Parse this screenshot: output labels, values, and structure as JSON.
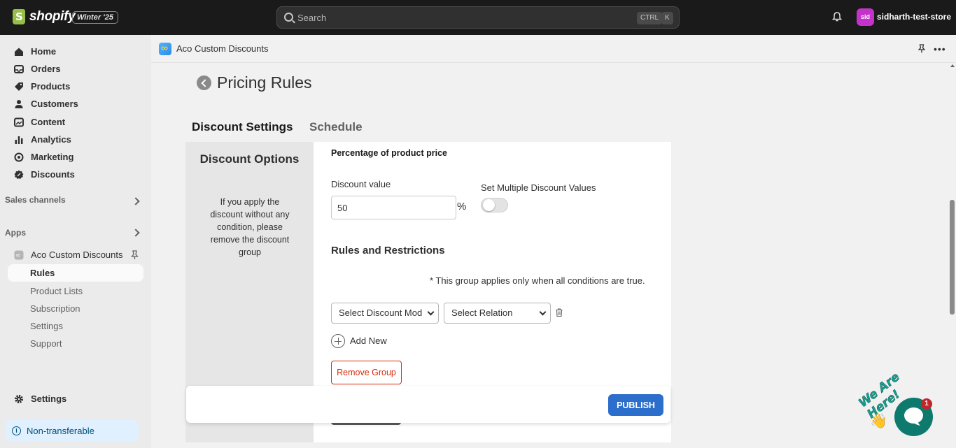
{
  "topbar": {
    "brand": "shopify",
    "edition_badge": "Winter '25",
    "search_placeholder": "Search",
    "kbd_ctrl": "CTRL",
    "kbd_k": "K",
    "store_initials": "sid",
    "store_name": "sidharth-test-store"
  },
  "sidebar": {
    "items": [
      {
        "label": "Home",
        "icon": "home-icon"
      },
      {
        "label": "Orders",
        "icon": "inbox-icon"
      },
      {
        "label": "Products",
        "icon": "tag-icon"
      },
      {
        "label": "Customers",
        "icon": "person-icon"
      },
      {
        "label": "Content",
        "icon": "image-icon"
      },
      {
        "label": "Analytics",
        "icon": "bar-chart-icon"
      },
      {
        "label": "Marketing",
        "icon": "target-icon"
      },
      {
        "label": "Discounts",
        "icon": "discount-icon"
      }
    ],
    "sales_channels": "Sales channels",
    "apps": "Apps",
    "app_name": "Aco Custom Discounts",
    "app_subitems": [
      "Rules",
      "Product Lists",
      "Subscription",
      "Settings",
      "Support"
    ],
    "settings": "Settings",
    "non_transferable": "Non-transferable"
  },
  "app_header": {
    "title": "Aco Custom Discounts"
  },
  "page": {
    "title": "Pricing Rules",
    "tabs": [
      "Discount Settings",
      "Schedule"
    ],
    "options_title": "Discount Options",
    "options_desc": "If you apply the discount without any condition, please remove the discount group",
    "percentage_label": "Percentage of product price",
    "discount_value_label": "Discount value",
    "discount_value": "50",
    "percent_sign": "%",
    "multiple_values_label": "Set Multiple Discount Values",
    "multiple_values_enabled": false,
    "rules_title": "Rules and Restrictions",
    "rules_note": "* This group applies only when all conditions are true.",
    "select_mode": "Select Discount Mod",
    "select_relation": "Select Relation",
    "add_new": "Add New",
    "remove_group": "Remove Group",
    "publish": "PUBLISH"
  },
  "chat": {
    "badge_count": "1",
    "greeting": "We Are Here!"
  },
  "colors": {
    "topbar_bg": "#1a1a1a",
    "publish_bg": "#2c6ecb",
    "remove_red": "#d72c0d",
    "chat_green": "#0e7a6e"
  }
}
